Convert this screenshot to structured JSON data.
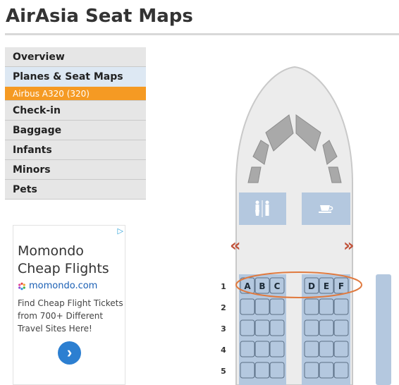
{
  "page": {
    "title": "AirAsia Seat Maps"
  },
  "sidebar": {
    "items": [
      {
        "label": "Overview"
      },
      {
        "label": "Planes & Seat Maps",
        "sub": "Airbus A320 (320)"
      },
      {
        "label": "Check-in"
      },
      {
        "label": "Baggage"
      },
      {
        "label": "Infants"
      },
      {
        "label": "Minors"
      },
      {
        "label": "Pets"
      }
    ]
  },
  "ad": {
    "title_line1": "Momondo",
    "title_line2": "Cheap Flights",
    "brand": "momondo.com",
    "description": "Find Cheap Flight Tickets from 700+ Different Travel Sites Here!",
    "choices_icon": "adchoices-icon",
    "button_icon": "chevron-right-icon"
  },
  "seatmap": {
    "left_seats": [
      "A",
      "B",
      "C"
    ],
    "right_seats": [
      "D",
      "E",
      "F"
    ],
    "rows": [
      "1",
      "2",
      "3",
      "4",
      "5"
    ],
    "lavatory_icon": "restroom-icon",
    "galley_icon": "coffee-cup-icon",
    "prev_glyph": "«",
    "next_glyph": "»",
    "highlighted_row": "1",
    "colors": {
      "seat_fill": "#b4c8df",
      "highlight": "#e07a3f",
      "fuselage": "#ececec"
    }
  }
}
